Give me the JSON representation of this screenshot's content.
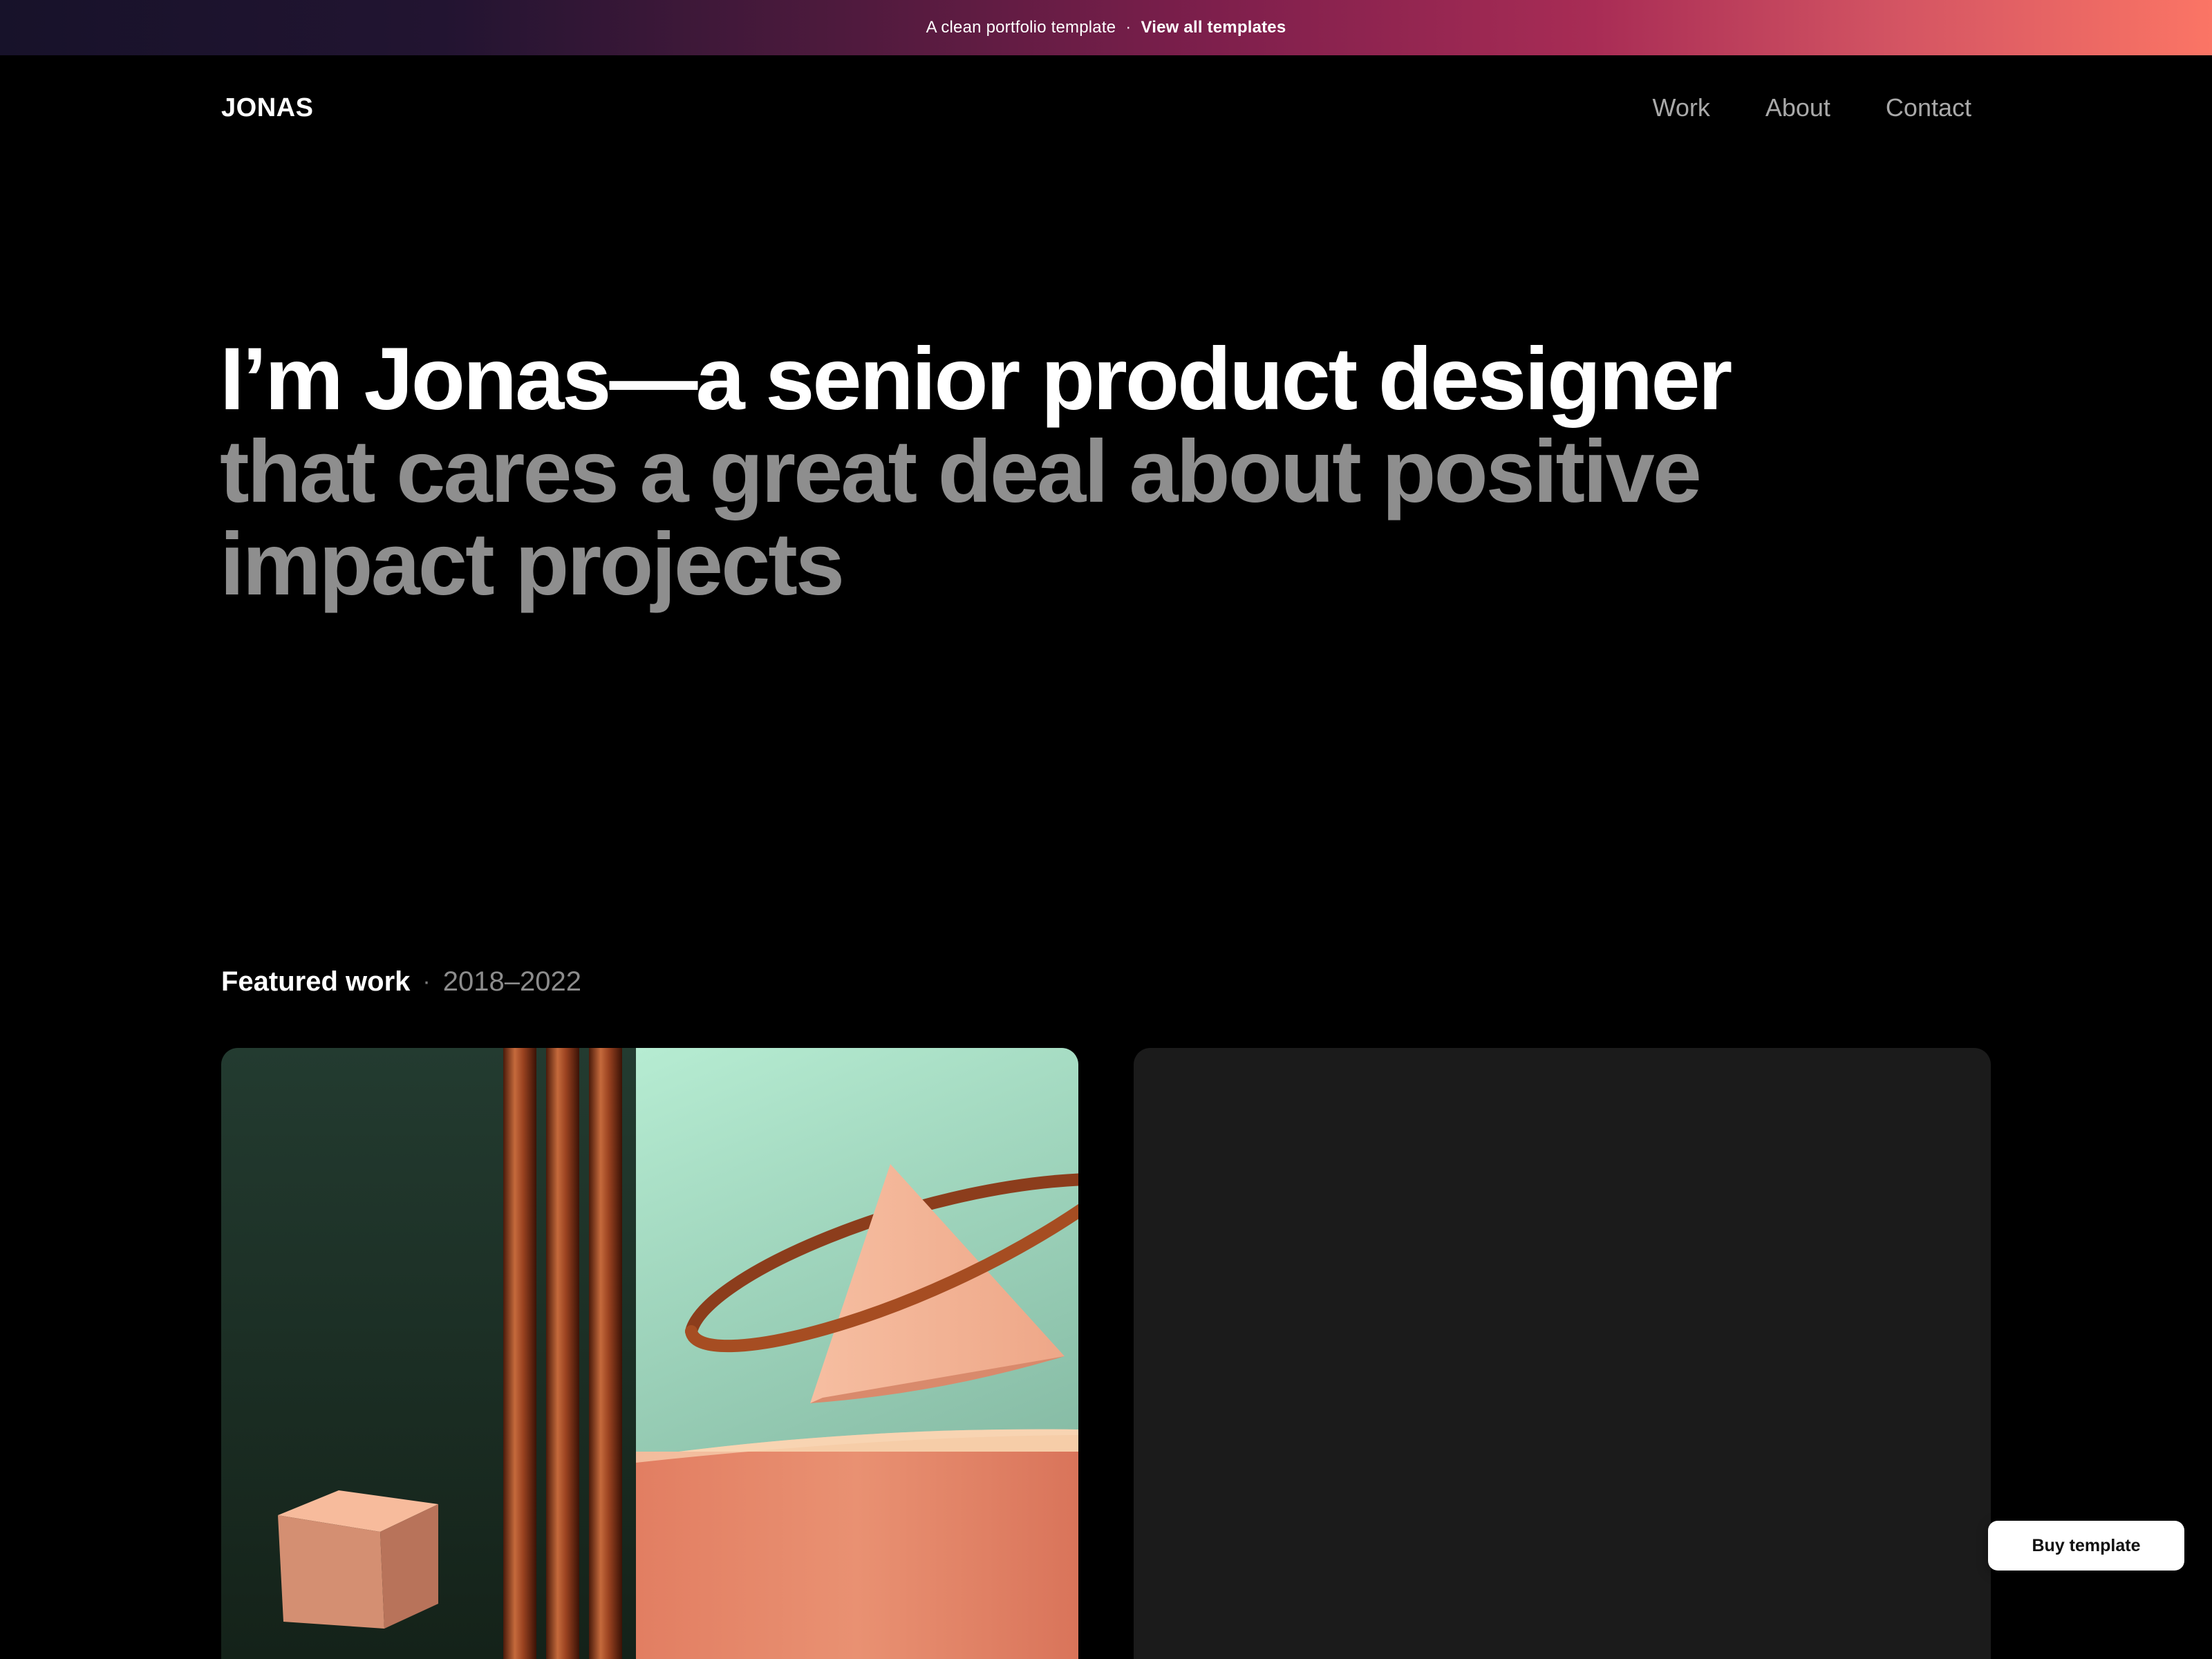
{
  "banner": {
    "text": "A clean portfolio template",
    "separator": "·",
    "link_label": "View all templates"
  },
  "nav": {
    "logo": "JONAS",
    "links": [
      "Work",
      "About",
      "Contact"
    ]
  },
  "hero": {
    "bright_part": "I’m Jonas—a senior product designer",
    "dim_part": "that cares a great deal about positive impact projects"
  },
  "featured": {
    "label": "Featured work",
    "separator": "·",
    "years": "2018–2022"
  },
  "cta": {
    "buy_label": "Buy template"
  },
  "colors": {
    "background": "#000000",
    "text_primary": "#ffffff",
    "text_muted": "#8e8e8e",
    "nav_link": "#a9a9a9",
    "card_dark": "#1b1b1b",
    "accent_peach": "#f2a582",
    "accent_copper": "#a34a24",
    "accent_mint": "#b2e9cc",
    "accent_forest": "#22372d"
  }
}
